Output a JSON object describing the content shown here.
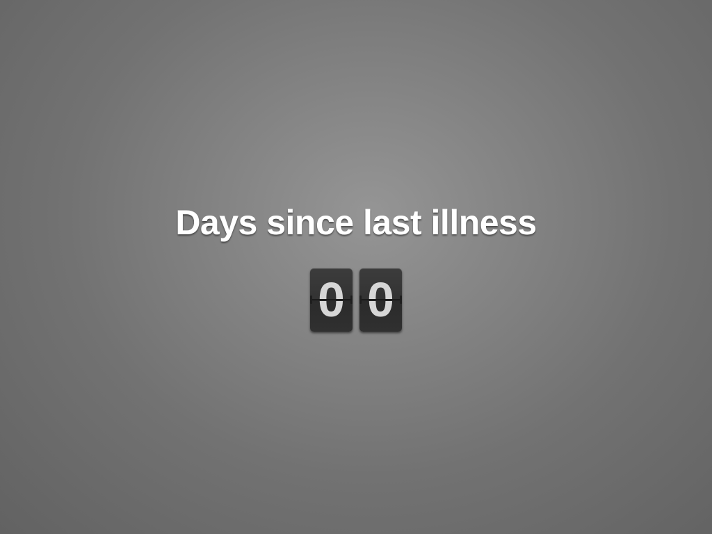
{
  "title": "Days since last illness",
  "counter": {
    "digits": [
      "0",
      "0"
    ]
  },
  "colors": {
    "background_center": "#959595",
    "background_edge": "#626262",
    "title_text": "#ffffff",
    "card_background": "#333333",
    "digit_text": "#d6d6d6"
  }
}
